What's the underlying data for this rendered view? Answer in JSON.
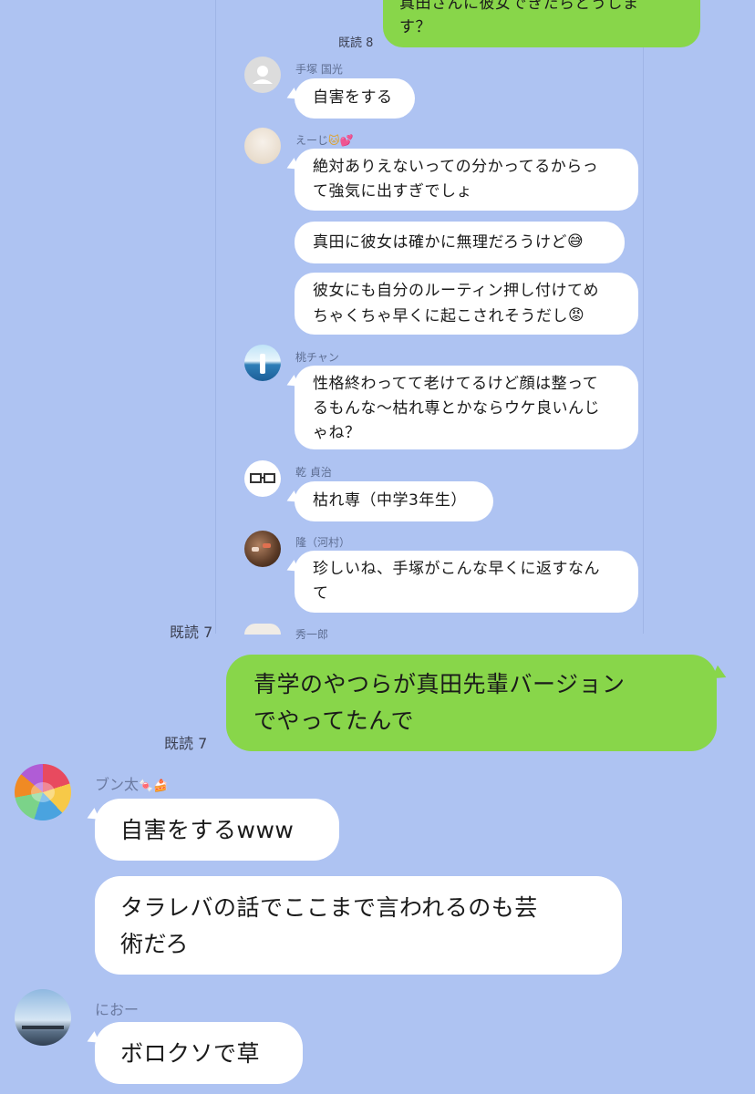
{
  "inner_chat": {
    "top_message": {
      "lines": [
        "真田さんに彼女できたらどうしま",
        "す？"
      ],
      "read": "既読 8"
    },
    "messages": [
      {
        "sender": "手塚 国光",
        "bubbles": [
          "自害をする"
        ]
      },
      {
        "sender": "えーじ",
        "bubbles": [
          [
            "絶対ありえないっての分かってるからっ",
            "て強気に出すぎでしょ"
          ],
          [
            "真田に彼女は確かに無理だろうけど"
          ],
          [
            "彼女にも自分のルーティン押し付けてめ",
            "ちゃくちゃ早くに起こされそうだし"
          ]
        ]
      },
      {
        "sender": "桃チャン",
        "bubbles": [
          [
            "性格終わってて老けてるけど顔は整って",
            "るもんな〜枯れ専とかならウケ良いんじ",
            "ゃね？"
          ]
        ]
      },
      {
        "sender": "乾 貞治",
        "bubbles": [
          [
            "枯れ専（中学3年生）"
          ]
        ]
      },
      {
        "sender": "隆（河村）",
        "bubbles": [
          [
            "珍しいね、手塚がこんな早くに返すなん",
            "て"
          ]
        ]
      },
      {
        "sender": "秀一郎"
      }
    ],
    "read_bottom": "既読 7"
  },
  "outer_chat": {
    "my_message": {
      "lines": [
        "青学のやつらが真田先輩バージョン",
        "でやってたんで"
      ],
      "read": "既読 7"
    },
    "buntaro": {
      "sender": "ブン太",
      "bubbles": [
        [
          "自害をするwww"
        ],
        [
          "タラレバの話でここまで言われるのも芸",
          "術だろ"
        ]
      ]
    },
    "nioh": {
      "sender": "におー",
      "bubbles": [
        [
          "ボロクソで草"
        ]
      ]
    }
  },
  "colors": {
    "background": "#aec3f2",
    "my_bubble": "#88d64a",
    "other_bubble": "#ffffff"
  }
}
